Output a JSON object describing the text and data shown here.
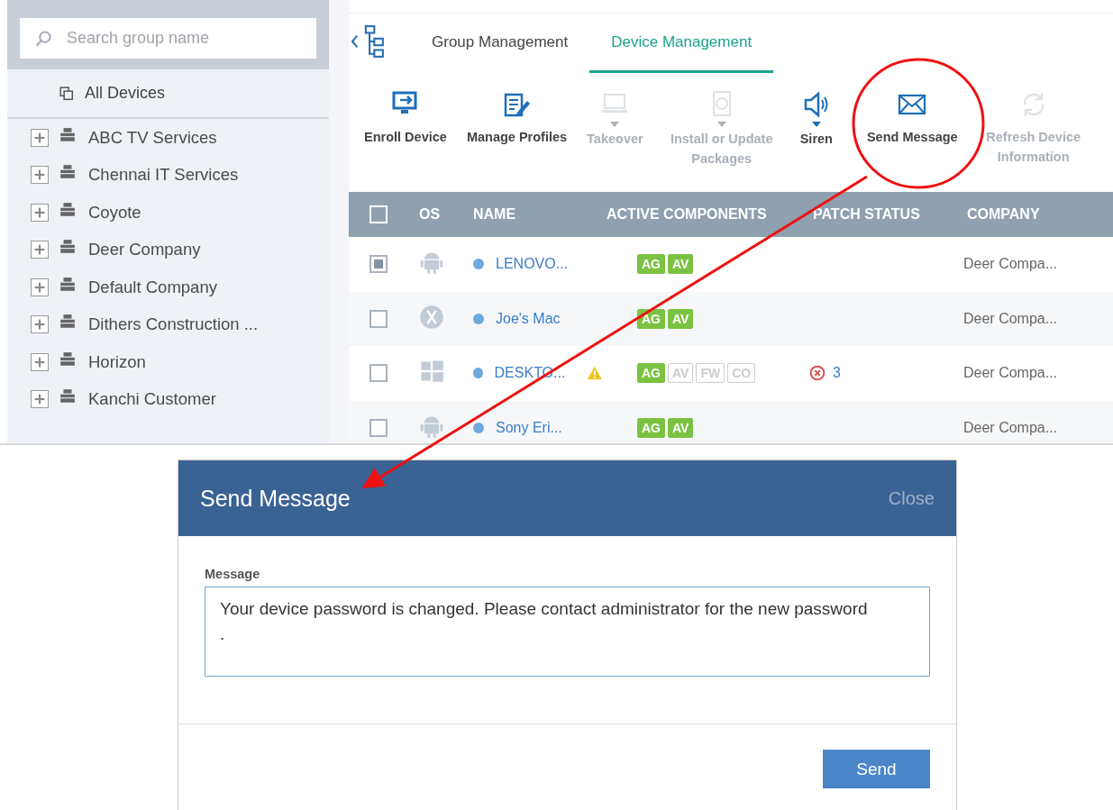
{
  "sidebar": {
    "search": {
      "placeholder": "Search group name"
    },
    "all_devices": "All Devices",
    "groups": [
      {
        "name": "ABC TV Services",
        "expanded": false
      },
      {
        "name": "Chennai IT Services",
        "expanded": false
      },
      {
        "name": "Coyote",
        "expanded": false
      },
      {
        "name": "Deer Company",
        "expanded": false
      },
      {
        "name": "Default Company",
        "expanded": false
      },
      {
        "name": "Dithers Construction ...",
        "expanded": false
      },
      {
        "name": "Horizon",
        "expanded": false
      },
      {
        "name": "Kanchi Customer",
        "expanded": false
      }
    ]
  },
  "tabs": [
    {
      "label": "Group Management",
      "selected": false
    },
    {
      "label": "Device Management",
      "selected": true
    }
  ],
  "toolbar": [
    {
      "kind": "enroll",
      "label": "Enroll Device",
      "disabled": false,
      "dropdown": false
    },
    {
      "kind": "profiles",
      "label": "Manage Profiles",
      "disabled": false,
      "dropdown": false
    },
    {
      "kind": "takeover",
      "label": "Takeover",
      "disabled": true,
      "dropdown": true
    },
    {
      "kind": "install",
      "label": "Install or Update Packages",
      "disabled": true,
      "dropdown": true
    },
    {
      "kind": "siren",
      "label": "Siren",
      "disabled": false,
      "dropdown": true
    },
    {
      "kind": "message",
      "label": "Send Message",
      "disabled": false,
      "dropdown": false
    },
    {
      "kind": "refresh",
      "label": "Refresh Device Information",
      "disabled": true,
      "dropdown": false
    }
  ],
  "table": {
    "select_all": {
      "checked": false
    },
    "columns": [
      "OS",
      "NAME",
      "ACTIVE COMPONENTS",
      "PATCH STATUS",
      "COMPANY"
    ],
    "rows": [
      {
        "selected": true,
        "kind": "android",
        "name": "LENOVO...",
        "warning": false,
        "components": [
          {
            "label": "AG",
            "on": true
          },
          {
            "label": "AV",
            "on": true
          }
        ],
        "company": "Deer Compa..."
      },
      {
        "selected": false,
        "kind": "mac",
        "name": "Joe's Mac",
        "warning": false,
        "components": [
          {
            "label": "AG",
            "on": true
          },
          {
            "label": "AV",
            "on": true
          }
        ],
        "company": "Deer Compa..."
      },
      {
        "selected": false,
        "kind": "windows",
        "name": "DESKTO...",
        "warning": true,
        "components": [
          {
            "label": "AG",
            "on": true
          },
          {
            "label": "AV",
            "on": false
          },
          {
            "label": "FW",
            "on": false
          },
          {
            "label": "CO",
            "on": false
          }
        ],
        "patch": "3",
        "company": "Deer Compa..."
      },
      {
        "selected": false,
        "kind": "android",
        "name": "Sony Eri...",
        "warning": false,
        "components": [
          {
            "label": "AG",
            "on": true
          },
          {
            "label": "AV",
            "on": true
          }
        ],
        "company": "Deer Compa..."
      }
    ]
  },
  "dialog": {
    "title": "Send Message",
    "close": "Close",
    "field_label": "Message",
    "value": "Your device password is changed. Please contact administrator for the new password\n.",
    "button": "Send"
  }
}
